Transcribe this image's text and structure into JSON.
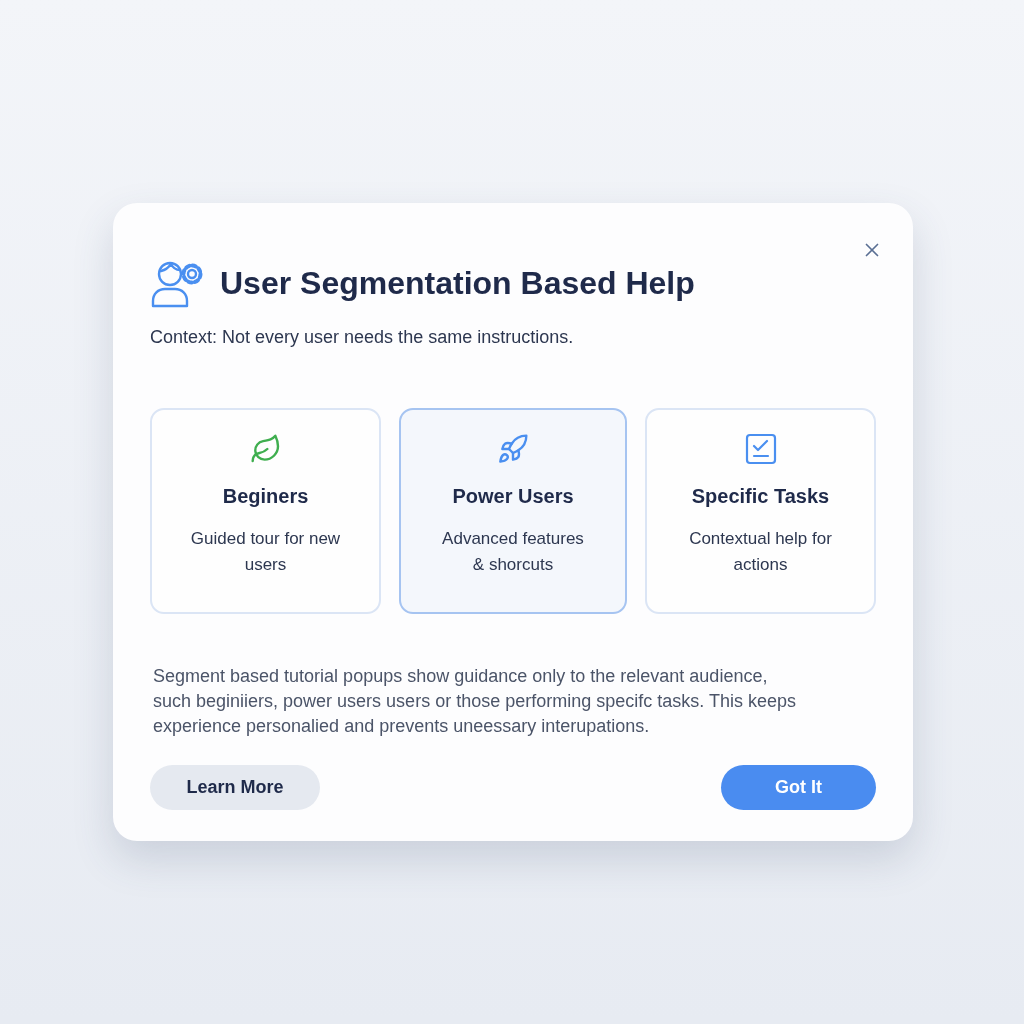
{
  "dialog": {
    "title": "User Segmentation Based Help",
    "context": "Context: Not every user needs the same instructions."
  },
  "segments": [
    {
      "kind": "beginner",
      "title": "Beginers",
      "description": "Guided tour for new users",
      "selected": false
    },
    {
      "kind": "power",
      "title": "Power Users",
      "description": "Advanced features & shorcuts",
      "selected": true
    },
    {
      "kind": "task",
      "title": "Specific Tasks",
      "description": "Contextual help for actions",
      "selected": false
    }
  ],
  "summary": "Segment based tutorial popups show guidance only to the relevant audience, such beginiiers, power users users or those performing specifc tasks. This keeps experience personalied and prevents uneessary interupations.",
  "buttons": [
    {
      "kind": "secondary",
      "label": "Learn More"
    },
    {
      "kind": "primary",
      "label": "Got It"
    }
  ]
}
